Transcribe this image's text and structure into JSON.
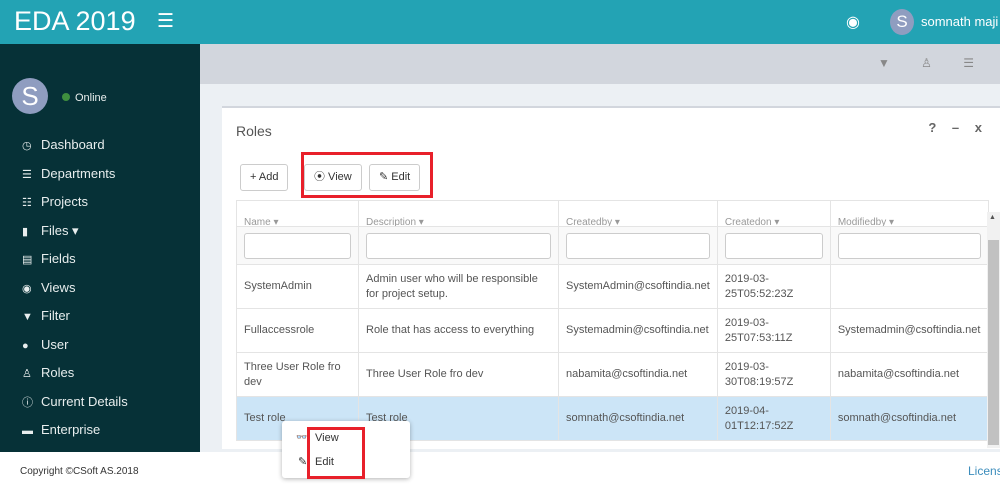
{
  "header": {
    "brand": "EDA 2019",
    "menu_icon": "☰",
    "eye_icon": "◉",
    "user_initial": "S",
    "user_name": "somnath maji ▾"
  },
  "sidebar": {
    "avatar_initial": "S",
    "status": "Online",
    "items": [
      {
        "icon": "◷",
        "label": "Dashboard"
      },
      {
        "icon": "☰",
        "label": "Departments"
      },
      {
        "icon": "☷",
        "label": "Projects"
      },
      {
        "icon": "▮",
        "label": "Files ▾"
      },
      {
        "icon": "▤",
        "label": "Fields"
      },
      {
        "icon": "◉",
        "label": "Views"
      },
      {
        "icon": "▼",
        "label": "Filter"
      },
      {
        "icon": "●",
        "label": "User"
      },
      {
        "icon": "♙",
        "label": "Roles"
      },
      {
        "icon": "ⓘ",
        "label": "Current Details"
      },
      {
        "icon": "▬",
        "label": "Enterprise"
      }
    ]
  },
  "toolbar_icons": "▼ ♙ ☰",
  "panel": {
    "title": "Roles",
    "tools": "? – x",
    "add": "+ Add",
    "view": "⦿ View",
    "edit": "✎ Edit"
  },
  "table": {
    "columns": [
      "Name ▾",
      "Description ▾",
      "Createdby ▾",
      "Createdon ▾",
      "Modifiedby ▾"
    ],
    "rows": [
      [
        "SystemAdmin",
        "Admin user who will be responsible for project setup.",
        "SystemAdmin@csoftindia.net",
        "2019-03-25T05:52:23Z",
        ""
      ],
      [
        "Fullaccessrole",
        "Role that has access to everything",
        "Systemadmin@csoftindia.net",
        "2019-03-25T07:53:11Z",
        "Systemadmin@csoftindia.net"
      ],
      [
        "Three User Role fro dev",
        "Three User Role fro dev",
        "nabamita@csoftindia.net",
        "2019-03-30T08:19:57Z",
        "nabamita@csoftindia.net"
      ],
      [
        "Test role",
        "Test role",
        "somnath@csoftindia.net",
        "2019-04-01T12:17:52Z",
        "somnath@csoftindia.net"
      ]
    ]
  },
  "context_menu": {
    "view": "View",
    "edit": "Edit",
    "view_icon": "👓",
    "edit_icon": "✎"
  },
  "footer": {
    "copyright": "Copyright ©CSoft AS.2018",
    "license": "Licens"
  }
}
